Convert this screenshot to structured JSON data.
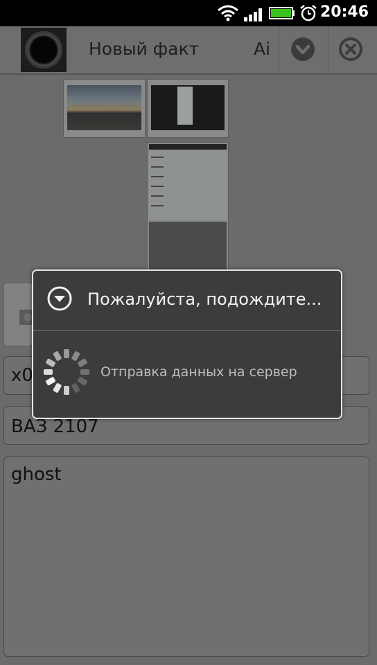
{
  "status_bar": {
    "time": "20:46",
    "icons": [
      "wifi-icon",
      "signal-icon",
      "battery-icon",
      "alarm-icon"
    ]
  },
  "action_bar": {
    "title": "Новый факт",
    "extra_text": "Аі",
    "buttons": [
      "chevron-down-icon",
      "close-icon"
    ]
  },
  "attachments": [
    "photo-thumbnail-sunset",
    "screenshot-thumbnail-1",
    "screenshot-thumbnail-2"
  ],
  "form": {
    "field1_value": "x0",
    "field2_value": "ВАЗ 2107",
    "field3_value": "ghost"
  },
  "dialog": {
    "title": "Пожалуйста, подождите...",
    "message": "Отправка данных на сервер"
  },
  "colors": {
    "dialog_bg": "#3b3d3a",
    "dim_overlay": "#6b6b6b",
    "statusbar_bg": "#000000",
    "battery_green": "#39c21c"
  }
}
